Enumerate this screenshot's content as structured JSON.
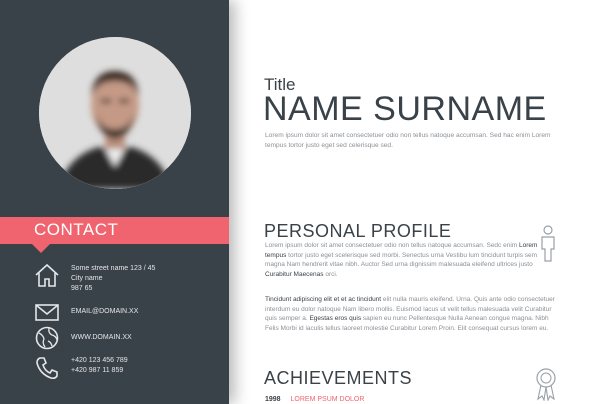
{
  "sidebar": {
    "contact_heading": "CONTACT",
    "address": [
      "Some street name 123 / 45",
      "City name",
      "987 65"
    ],
    "email": "EMAIL@DOMAIN.XX",
    "web": "WWW.DOMAIN.XX",
    "phones": [
      "+420 123 456 789",
      "+420 987 11 859"
    ],
    "icons": [
      "home-icon",
      "envelope-icon",
      "globe-icon",
      "phone-icon"
    ]
  },
  "header": {
    "title": "Title",
    "name": "NAME SURNAME",
    "intro": "Lorem ipsum dolor sit amet consectetuer odio non tellus natoque accumsan. Sed hac enim Lorem tempus tortor justo eget sed celerisque sed."
  },
  "profile": {
    "heading": "PERSONAL PROFILE",
    "p1": [
      {
        "t": "Lorem ipsum dolor sit amet consectetuer odio non tellus natoque accumsan. Sedc enim ",
        "b": false
      },
      {
        "t": "Lorem tempus",
        "b": true
      },
      {
        "t": " tortor justo eget scelerisque sed morbi. Senectus urna Vestibu lum tincidunt turpis sem magna Nam hendrerit vitae nibh. Auctor Sed urna dignissim malesuada eleifend ultrices justo ",
        "b": false
      },
      {
        "t": "Curabitur Maecenas",
        "b": true
      },
      {
        "t": " orci.",
        "b": false
      }
    ],
    "p2": [
      {
        "t": "Tincidunt adipiscing elit et et ac tincidunt",
        "b": true
      },
      {
        "t": " elit nulla mauris eleifend. Urna. Quis ante odio consectetuer interdum eu dolor natoque Nam libero mollis. Euismod lacus ut velit tellus malesuada velit Curabitur quis semper a. ",
        "b": false
      },
      {
        "t": "Egestas eros quis",
        "b": true
      },
      {
        "t": " sapien eu nunc Pellentesque Nulla Aenean congue magna. Nibh Felis Morbi id iaculis tellus laoreet molestie Curabitur Lorem Proin. Elit consequat cursus lorem eu.",
        "b": false
      }
    ]
  },
  "achievements": {
    "heading": "ACHIEVEMENTS",
    "items": [
      {
        "year": "1998",
        "label": "LOREM PSUM DOLOR"
      }
    ]
  },
  "colors": {
    "sidebar": "#3a4249",
    "accent": "#f06470",
    "text_dark": "#3a4249",
    "text_muted": "#8b9096"
  }
}
